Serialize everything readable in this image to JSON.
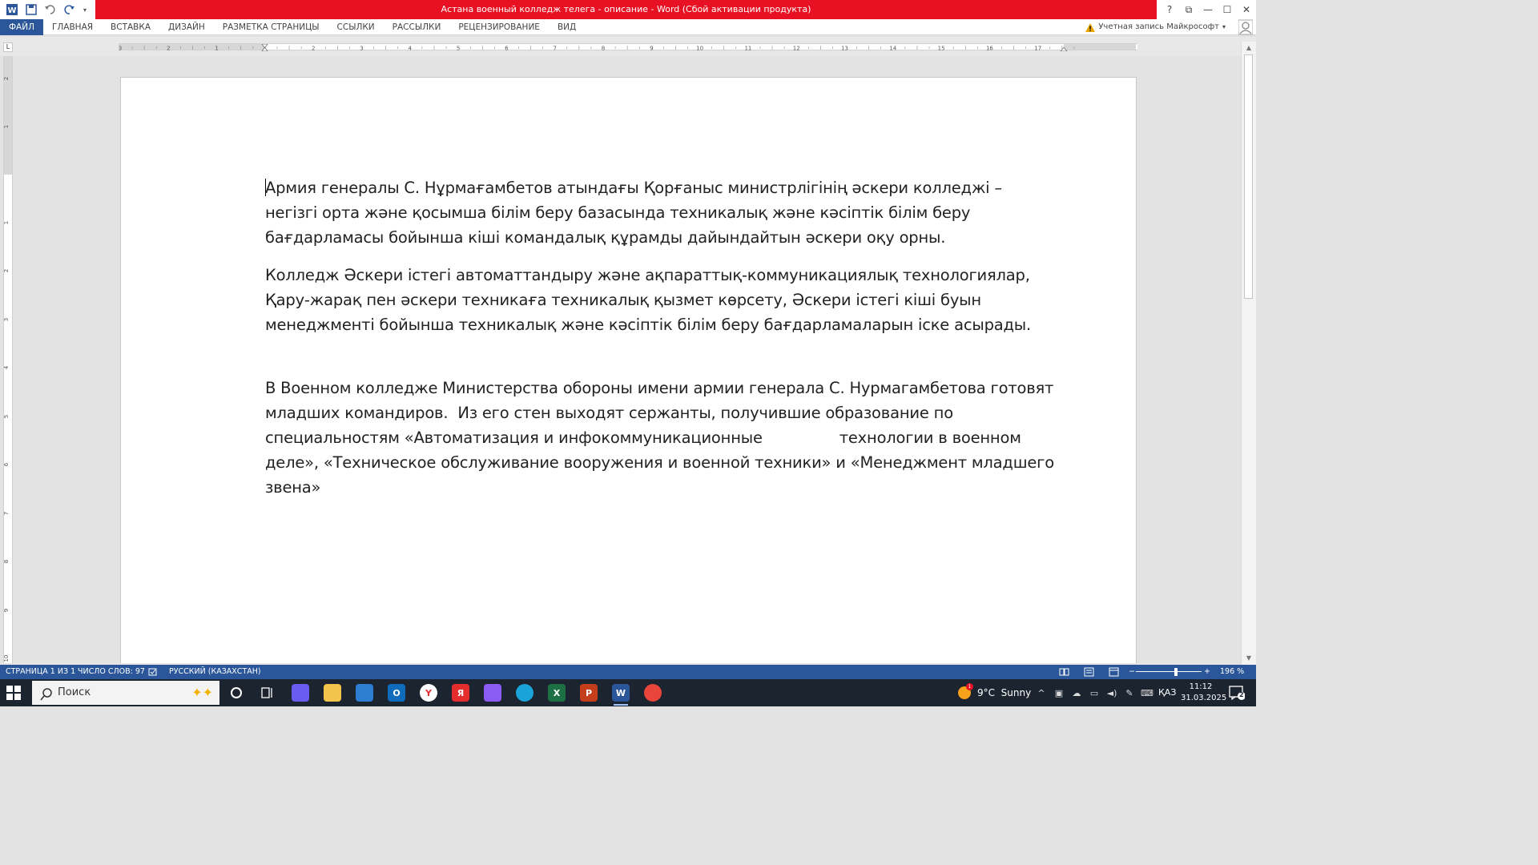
{
  "window": {
    "title": "Астана военный колледж телега - описание -  Word (Сбой активации продукта)",
    "controls": [
      "?",
      "⧉",
      "—",
      "☐",
      "✕"
    ]
  },
  "qat": {
    "icons": [
      "word-app-icon",
      "save-icon",
      "undo-icon",
      "redo-icon",
      "customize-qat-icon"
    ]
  },
  "ribbon": {
    "tabs": [
      "ФАЙЛ",
      "ГЛАВНАЯ",
      "ВСТАВКА",
      "ДИЗАЙН",
      "РАЗМЕТКА СТРАНИЦЫ",
      "ССЫЛКИ",
      "РАССЫЛКИ",
      "РЕЦЕНЗИРОВАНИЕ",
      "ВИД"
    ],
    "account_label": "Учетная запись Майкрософт"
  },
  "ruler": {
    "tab_selector": "L",
    "h_numbers": [
      "3",
      "2",
      "1",
      "1",
      "2",
      "3",
      "4",
      "5",
      "6",
      "7",
      "8",
      "9",
      "10",
      "11",
      "12",
      "13",
      "14",
      "15",
      "16",
      "17"
    ],
    "v_numbers": [
      "2",
      "1",
      "1",
      "2",
      "3",
      "4",
      "5",
      "6",
      "7",
      "8",
      "9",
      "10"
    ]
  },
  "document": {
    "paragraphs": [
      "Армия генералы С. Нұрмағамбетов атындағы Қорғаныс министрлігінің әскери колледжі – негізгі орта және қосымша білім беру базасында техникалық және кәсіптік білім беру бағдарламасы бойынша кіші командалық құрамды дайындайтын әскери оқу орны.",
      "Колледж Әскери істегі автоматтандыру және ақпараттық-коммуникациялық технологиялар, Қару-жарақ пен әскери техникаға техникалық қызмет көрсету, Әскери істегі кіші буын менеджменті бойынша техникалық және кәсіптік білім беру бағдарламаларын іске асырады.",
      "В Военном колледже Министерства обороны имени армии генерала С. Нурмагамбетова готовят младших командиров.  Из его стен выходят сержанты, получившие образование по специальностям «Автоматизация и инфокоммуникационные                технологии в военном деле», «Техническое обслуживание вооружения и военной техники» и «Менеджмент младшего звена»"
    ]
  },
  "status": {
    "page": "СТРАНИЦА 1 ИЗ 1",
    "words": "ЧИСЛО СЛОВ: 97",
    "language": "РУССКИЙ (КАЗАХСТАН)",
    "zoom": "196 %",
    "zoom_minus": "−",
    "zoom_plus": "+"
  },
  "taskbar": {
    "search_placeholder": "Поиск",
    "weather": "9°C  Sunny",
    "weather_badge": "1",
    "lang": "ҚАЗ",
    "time": "11:12",
    "date": "31.03.2025",
    "notif_count": "2",
    "apps": [
      {
        "name": "copilot-icon",
        "color": "#6a5cf0",
        "label": ""
      },
      {
        "name": "file-explorer-icon",
        "color": "#f2c44b",
        "label": ""
      },
      {
        "name": "store-icon",
        "color": "#2d7dd2",
        "label": ""
      },
      {
        "name": "outlook-icon",
        "color": "#0f6cbd",
        "label": "O"
      },
      {
        "name": "yandex-browser-icon",
        "color": "#ffffff",
        "label": "Y"
      },
      {
        "name": "yandex-icon",
        "color": "#e62d2d",
        "label": "Я"
      },
      {
        "name": "m365-icon",
        "color": "#8a5cf5",
        "label": ""
      },
      {
        "name": "edge-icon",
        "color": "#1aa3d9",
        "label": ""
      },
      {
        "name": "excel-icon",
        "color": "#1d7044",
        "label": "X"
      },
      {
        "name": "powerpoint-icon",
        "color": "#c43e1c",
        "label": "P"
      },
      {
        "name": "word-icon",
        "color": "#2b579a",
        "label": "W"
      },
      {
        "name": "chrome-icon",
        "color": "#e9453a",
        "label": ""
      }
    ]
  }
}
